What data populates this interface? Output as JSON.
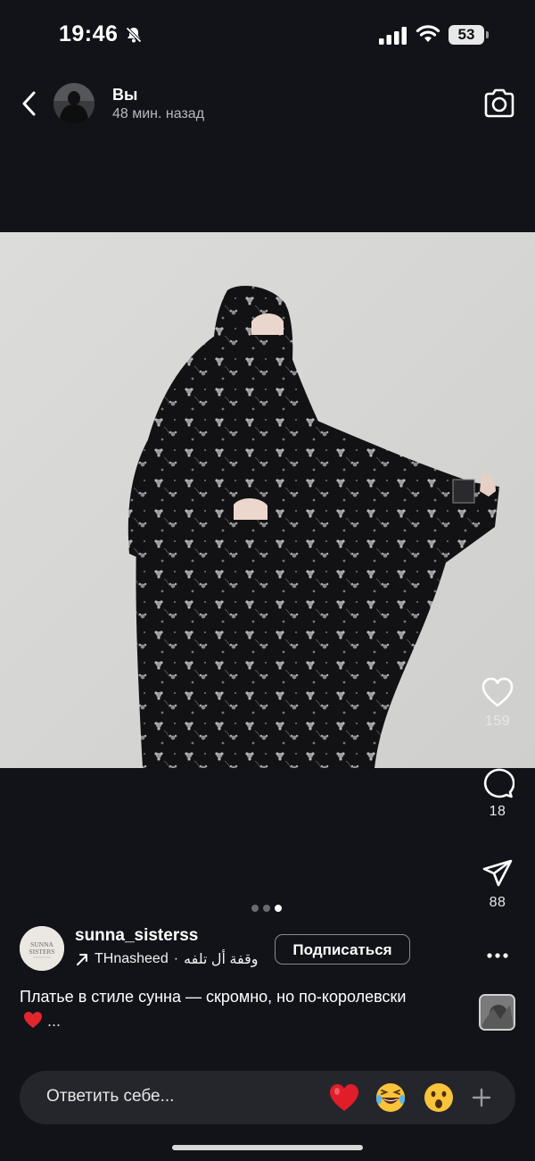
{
  "status_bar": {
    "time": "19:46",
    "battery": "53"
  },
  "header": {
    "name": "Вы",
    "time_ago": "48 мин. назад"
  },
  "actions": {
    "likes": "159",
    "comments": "18",
    "shares": "88"
  },
  "carousel": {
    "total": 3,
    "active_index": 2
  },
  "author": {
    "username": "sunna_sisterss",
    "avatar_text": "SUNNA SISTERS",
    "music_artist": "THnasheed",
    "music_separator": "·",
    "music_title": "وقفة أل تلفه",
    "subscribe_label": "Подписаться"
  },
  "caption": {
    "text": "Платье в стиле сунна — скромно, но по-королевски",
    "ellipsis": "..."
  },
  "reply": {
    "placeholder": "Ответить себе..."
  },
  "icons": [
    "back-icon",
    "camera-icon",
    "heart-icon",
    "comment-icon",
    "share-icon",
    "more-icon",
    "music-arrow-icon",
    "plus-icon"
  ]
}
